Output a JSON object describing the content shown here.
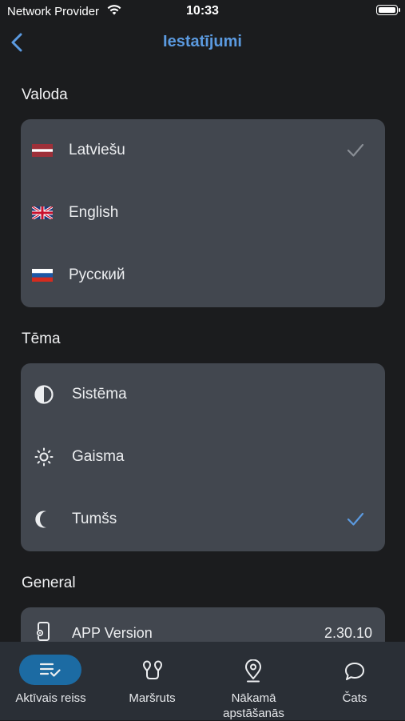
{
  "status_bar": {
    "carrier": "Network Provider",
    "time": "10:33"
  },
  "header": {
    "title": "Iestatījumi"
  },
  "language_section": {
    "title": "Valoda",
    "items": [
      {
        "label": "Latviešu",
        "flag": "latvia-flag",
        "selected": true
      },
      {
        "label": "English",
        "flag": "uk-flag",
        "selected": false
      },
      {
        "label": "Русский",
        "flag": "russia-flag",
        "selected": false
      }
    ]
  },
  "theme_section": {
    "title": "Tēma",
    "items": [
      {
        "label": "Sistēma",
        "icon": "half-circle-icon",
        "selected": false
      },
      {
        "label": "Gaisma",
        "icon": "sun-icon",
        "selected": false
      },
      {
        "label": "Tumšs",
        "icon": "moon-icon",
        "selected": true
      }
    ]
  },
  "general_section": {
    "title": "General",
    "items": [
      {
        "label": "APP Version",
        "value": "2.30.10",
        "icon": "phone-gear-icon"
      }
    ]
  },
  "tab_bar": {
    "tabs": [
      {
        "label": "Aktīvais reiss",
        "icon": "active-trip-icon",
        "active": true
      },
      {
        "label": "Maršruts",
        "icon": "route-icon",
        "active": false
      },
      {
        "label": "Nākamā apstāšanās",
        "icon": "location-pin-icon",
        "active": false
      },
      {
        "label": "Čats",
        "icon": "chat-icon",
        "active": false
      }
    ]
  },
  "colors": {
    "background": "#1b1c1e",
    "card": "#42474f",
    "accent": "#5b9ae0",
    "tab_bar": "#2a2f36",
    "active_pill": "#1c6ba3",
    "check_muted": "#8a8f96"
  }
}
